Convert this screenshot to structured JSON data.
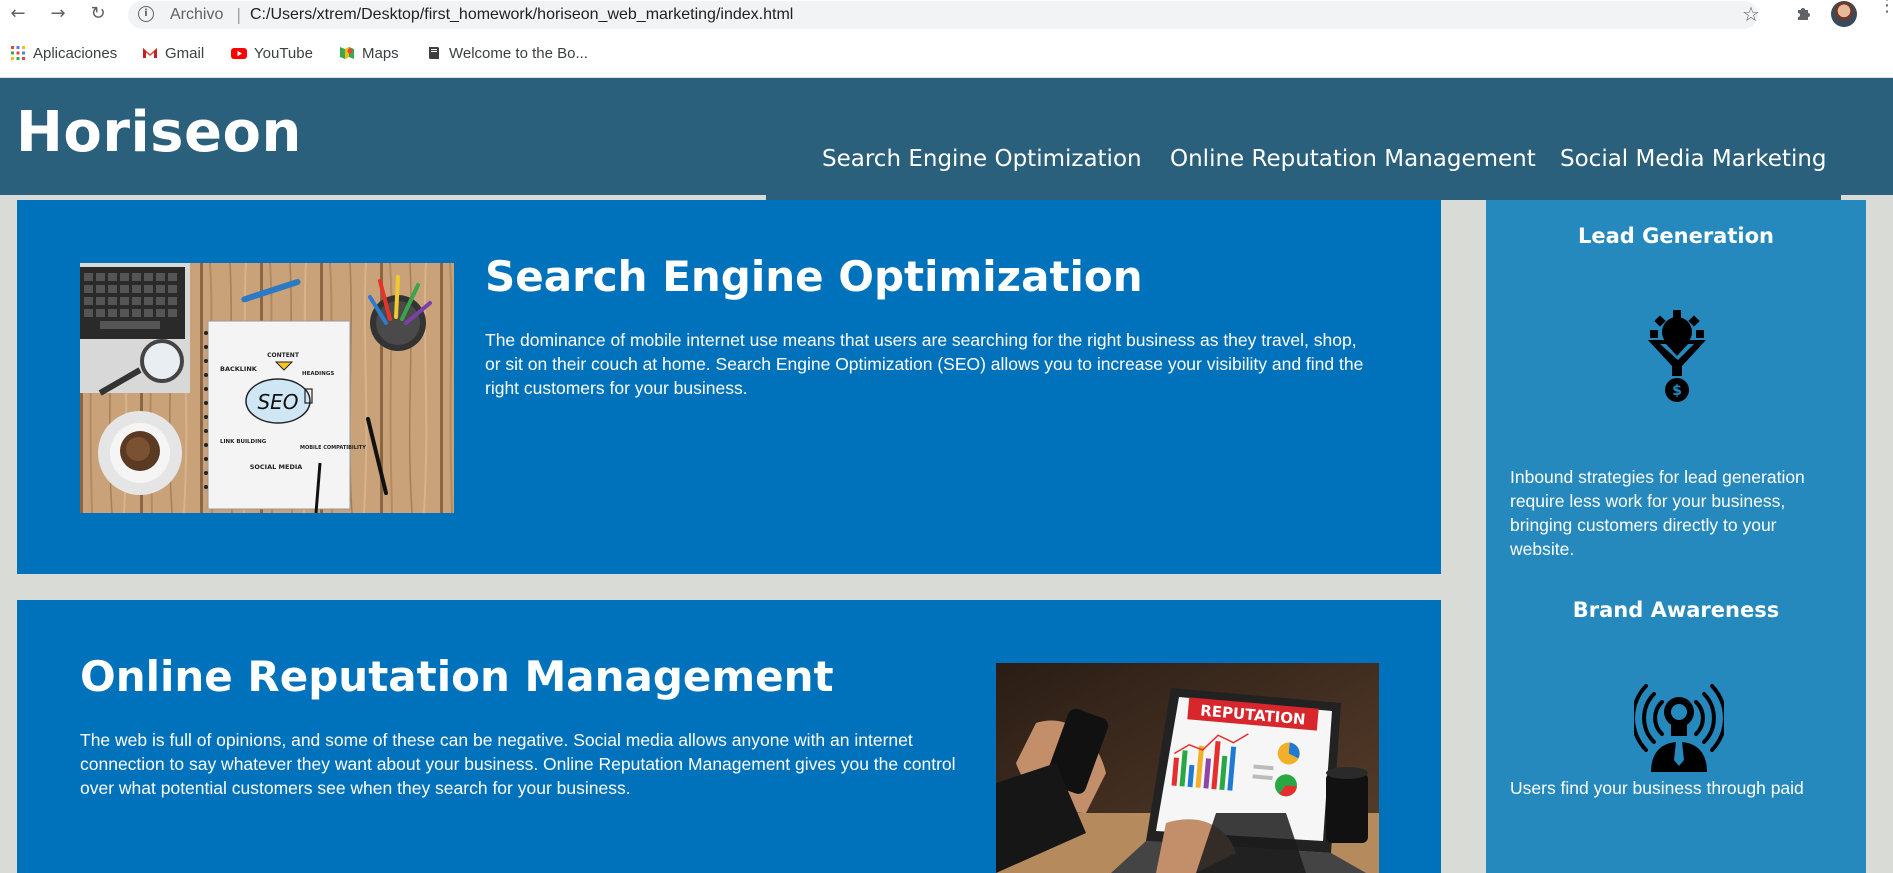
{
  "browser": {
    "omnibox_label": "Archivo",
    "separator": "|",
    "url": "C:/Users/xtrem/Desktop/first_homework/horiseon_web_marketing/index.html",
    "bookmarks": [
      {
        "label": "Aplicaciones",
        "icon": "apps-grid-icon"
      },
      {
        "label": "Gmail",
        "icon": "gmail-icon"
      },
      {
        "label": "YouTube",
        "icon": "youtube-icon"
      },
      {
        "label": "Maps",
        "icon": "maps-icon"
      },
      {
        "label": "Welcome to the Bo...",
        "icon": "book-icon"
      }
    ]
  },
  "header": {
    "logo": "Horiseon",
    "nav": [
      "Search Engine Optimization",
      "Online Reputation Management",
      "Social Media Marketing"
    ]
  },
  "content": [
    {
      "title": "Search Engine Optimization",
      "text": "The dominance of mobile internet use means that users are searching for the right business as they travel, shop, or sit on their couch at home. Search Engine Optimization (SEO) allows you to increase your visibility and find the right customers for your business.",
      "image_labels": {
        "center": "SEO",
        "top": "CONTENT",
        "left": "BACKLINK",
        "right": "HEADINGS",
        "bottom_left": "LINK BUILDING",
        "bottom_right": "MOBILE COMPATIBILITY",
        "bottom": "SOCIAL MEDIA"
      }
    },
    {
      "title": "Online Reputation Management",
      "text": "The web is full of opinions, and some of these can be negative. Social media allows anyone with an internet connection to say whatever they want about your business. Online Reputation Management gives you the control over what potential customers see when they search for your business.",
      "image_labels": {
        "banner": "REPUTATION"
      }
    }
  ],
  "aside": [
    {
      "title": "Lead Generation",
      "text": "Inbound strategies for lead generation require less work for your business, bringing customers directly to your website.",
      "icon": "lead-generation-icon"
    },
    {
      "title": "Brand Awareness",
      "text": "Users find your business through paid",
      "icon": "brand-awareness-icon"
    }
  ],
  "colors": {
    "header_bg": "#2a607c",
    "card_bg": "#0072bb",
    "aside_bg": "#2589bd",
    "page_bg": "#d9dcd6"
  }
}
